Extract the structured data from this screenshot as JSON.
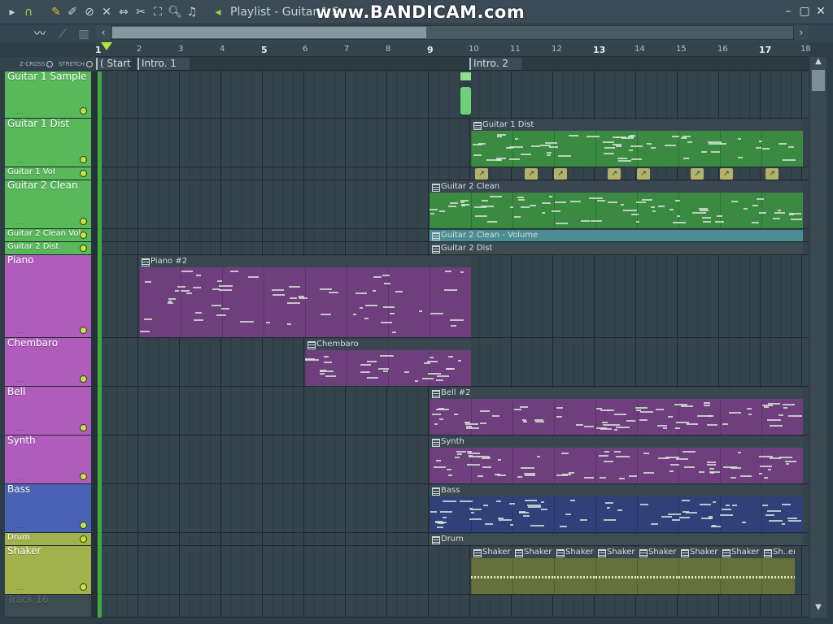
{
  "window": {
    "title": "Playlist - Guitar 1 S",
    "watermark": "www.BANDICAM.com"
  },
  "toolbar": {
    "icons": [
      "arrow-right-icon",
      "magnet-icon",
      "pencil-icon",
      "paint-icon",
      "delete-icon",
      "mute-icon",
      "slip-icon",
      "slice-icon",
      "select-icon",
      "zoom-icon",
      "speaker-icon"
    ],
    "view_icons": [
      "waveform-icon",
      "automation-icon",
      "piano-roll-icon"
    ]
  },
  "options": {
    "zcross": "Z-CROSS",
    "stretch": "STRETCH"
  },
  "ruler": {
    "ticks": [
      "1",
      "2",
      "3",
      "4",
      "5",
      "6",
      "7",
      "8",
      "9",
      "10",
      "11",
      "12",
      "13",
      "14",
      "15",
      "16",
      "17",
      "18"
    ],
    "major": [
      "1",
      "5",
      "9",
      "13",
      "17"
    ]
  },
  "markers": [
    {
      "label": "( Start",
      "bar": 1
    },
    {
      "label": "Intro. 1",
      "bar": 2
    },
    {
      "label": "Intro. 2",
      "bar": 10
    }
  ],
  "tracks": [
    {
      "name": "Guitar 1 Sample",
      "color": "#58b85a",
      "height": 58
    },
    {
      "name": "Guitar 1 Dist",
      "color": "#58b85a",
      "height": 60
    },
    {
      "name": "Guitar 1 Vol",
      "color": "#58b85a",
      "height": 16,
      "small": true
    },
    {
      "name": "Guitar 2 Clean",
      "color": "#58b85a",
      "height": 60
    },
    {
      "name": "Guitar 2 Clean Vol.",
      "color": "#58b85a",
      "height": 16,
      "small": true
    },
    {
      "name": "Guitar 2 Dist",
      "color": "#58b85a",
      "height": 16,
      "small": true
    },
    {
      "name": "Piano",
      "color": "#b05cbd",
      "height": 102
    },
    {
      "name": "Chembaro",
      "color": "#b05cbd",
      "height": 60
    },
    {
      "name": "Bell",
      "color": "#b05cbd",
      "height": 60
    },
    {
      "name": "Synth",
      "color": "#b05cbd",
      "height": 60
    },
    {
      "name": "Bass",
      "color": "#4a62b4",
      "height": 60
    },
    {
      "name": "Drum",
      "color": "#a1b24c",
      "height": 16,
      "small": true
    },
    {
      "name": "Shaker",
      "color": "#a1b24c",
      "height": 60
    },
    {
      "name": "Track 16",
      "color": "#3d4b53",
      "height": 28,
      "empty": true
    }
  ],
  "clips": [
    {
      "label": "",
      "track": 0,
      "start": 9.75,
      "end": 10.0,
      "color": "#6fd07a",
      "kind": "audio"
    },
    {
      "label": "Guitar 1 Dist",
      "track": 1,
      "start": 10,
      "end": 18,
      "color": "#3b8a42",
      "kind": "notes"
    },
    {
      "label": "",
      "track": 2,
      "start": 10,
      "end": 18,
      "color": "#2d3a42",
      "kind": "automation",
      "points": [
        10.1,
        11.3,
        12.0,
        13.3,
        14.0,
        15.3,
        16.0,
        17.1
      ]
    },
    {
      "label": "Guitar 2 Clean",
      "track": 3,
      "start": 9,
      "end": 18,
      "color": "#3b8a42",
      "kind": "notes"
    },
    {
      "label": "Guitar 2 Clean - Volume",
      "track": 4,
      "start": 9,
      "end": 18,
      "color": "#4a8d93",
      "kind": "bar"
    },
    {
      "label": "Guitar 2 Dist",
      "track": 5,
      "start": 9,
      "end": 18,
      "color": "#3d4b53",
      "kind": "bar"
    },
    {
      "label": "Piano #2",
      "track": 6,
      "start": 2,
      "end": 10,
      "color": "#6e3f7c",
      "kind": "notes"
    },
    {
      "label": "Chembaro",
      "track": 7,
      "start": 6,
      "end": 10,
      "color": "#6e3f7c",
      "kind": "notes"
    },
    {
      "label": "Bell #2",
      "track": 8,
      "start": 9,
      "end": 18,
      "color": "#6e3f7c",
      "kind": "notes"
    },
    {
      "label": "Synth",
      "track": 9,
      "start": 9,
      "end": 18,
      "color": "#6e3f7c",
      "kind": "notes"
    },
    {
      "label": "Bass",
      "track": 10,
      "start": 9,
      "end": 18,
      "color": "#2f4178",
      "kind": "notes"
    },
    {
      "label": "Drum",
      "track": 11,
      "start": 9,
      "end": 18,
      "color": "#3d4b53",
      "kind": "bar"
    },
    {
      "label": "Shaker",
      "track": 12,
      "start": 10,
      "end": 11,
      "color": "#66703a",
      "kind": "drum"
    },
    {
      "label": "Shaker",
      "track": 12,
      "start": 11,
      "end": 12,
      "color": "#66703a",
      "kind": "drum"
    },
    {
      "label": "Shaker",
      "track": 12,
      "start": 12,
      "end": 13,
      "color": "#66703a",
      "kind": "drum"
    },
    {
      "label": "Shaker",
      "track": 12,
      "start": 13,
      "end": 14,
      "color": "#66703a",
      "kind": "drum"
    },
    {
      "label": "Shaker",
      "track": 12,
      "start": 14,
      "end": 15,
      "color": "#66703a",
      "kind": "drum"
    },
    {
      "label": "Shaker",
      "track": 12,
      "start": 15,
      "end": 16,
      "color": "#66703a",
      "kind": "drum"
    },
    {
      "label": "Shaker",
      "track": 12,
      "start": 16,
      "end": 17,
      "color": "#66703a",
      "kind": "drum"
    },
    {
      "label": "Sh..er",
      "track": 12,
      "start": 17,
      "end": 17.8,
      "color": "#66703a",
      "kind": "drum"
    }
  ]
}
